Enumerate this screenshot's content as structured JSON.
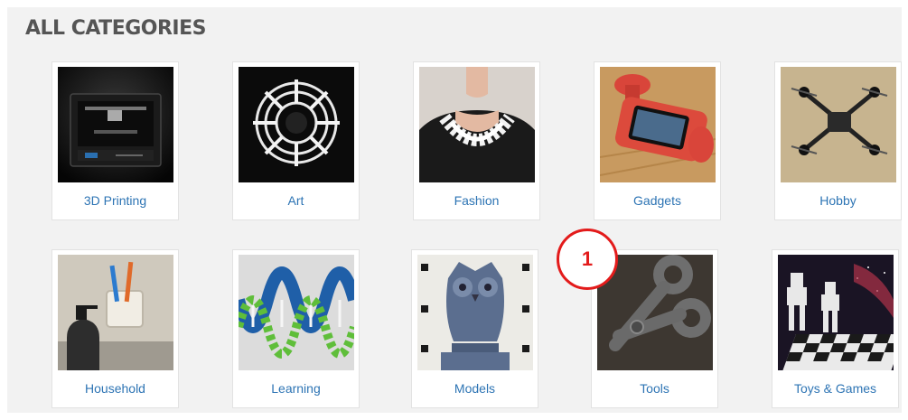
{
  "page": {
    "title": "ALL CATEGORIES"
  },
  "categories": [
    {
      "label": "3D Printing"
    },
    {
      "label": "Art"
    },
    {
      "label": "Fashion"
    },
    {
      "label": "Gadgets"
    },
    {
      "label": "Hobby"
    },
    {
      "label": "Household"
    },
    {
      "label": "Learning"
    },
    {
      "label": "Models"
    },
    {
      "label": "Tools"
    },
    {
      "label": "Toys & Games"
    }
  ],
  "annotation": {
    "marker_label": "1"
  },
  "colors": {
    "panel_bg": "#f2f2f2",
    "link": "#2d74b4",
    "title": "#555555",
    "marker": "#e31b1b"
  }
}
